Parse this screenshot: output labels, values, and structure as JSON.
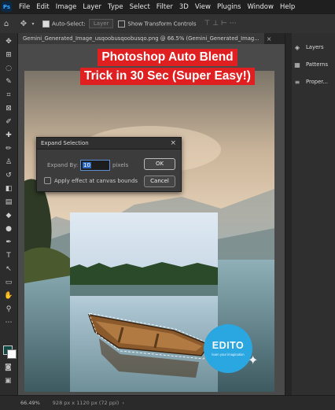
{
  "app": {
    "logo_text": "Ps"
  },
  "menu": [
    "File",
    "Edit",
    "Image",
    "Layer",
    "Type",
    "Select",
    "Filter",
    "3D",
    "View",
    "Plugins",
    "Window",
    "Help"
  ],
  "options_bar": {
    "auto_select_label": "Auto-Select:",
    "layer_value": "Layer",
    "transform_label": "Show Transform Controls"
  },
  "document_tabs": [
    "Gemini_Generated_Image_usqoobusqoobusqo.png @ 66.5% (Gemini_Generated_Imag..."
  ],
  "tools": [
    "move-tool-icon",
    "artboard-icon",
    "lasso-icon",
    "quick-select-icon",
    "crop-icon",
    "frame-icon",
    "eyedropper-icon",
    "healing-brush-icon",
    "brush-icon",
    "clone-stamp-icon",
    "history-brush-icon",
    "eraser-icon",
    "gradient-icon",
    "blur-icon",
    "dodge-icon",
    "pen-icon",
    "type-icon",
    "path-select-icon",
    "rectangle-icon",
    "hand-icon",
    "zoom-icon",
    "more-tools-icon"
  ],
  "tool_glyphs": [
    "✥",
    "⊞",
    "◌",
    "✎",
    "⌗",
    "⊠",
    "✐",
    "✚",
    "✏",
    "♙",
    "↺",
    "◧",
    "▤",
    "◆",
    "●",
    "✒",
    "T",
    "↖",
    "▭",
    "✋",
    "⚲",
    "⋯"
  ],
  "colors": {
    "foreground": "#0f4a45",
    "background": "#ffffff",
    "title_bg": "#e02020",
    "logo_bg": "#2aa6e0"
  },
  "panels": [
    {
      "icon": "layers-icon",
      "glyph": "◈",
      "label": "Layers"
    },
    {
      "icon": "patterns-icon",
      "glyph": "▦",
      "label": "Patterns"
    },
    {
      "icon": "properties-icon",
      "glyph": "≡",
      "label": "Proper..."
    }
  ],
  "video_title": {
    "line1": "Photoshop Auto Blend",
    "line2": "Trick in 30 Sec (Super Easy!)"
  },
  "dialog": {
    "title": "Expand Selection",
    "expand_by_label": "Expand By:",
    "expand_by_value": "10",
    "unit": "pixels",
    "checkbox_label": "Apply effect at canvas bounds",
    "ok_label": "OK",
    "cancel_label": "Cancel"
  },
  "watermark": {
    "text": "EDITO",
    "tagline": "learn your imagination"
  },
  "status": {
    "zoom": "66.49%",
    "doc_info": "928 px x 1120 px (72 ppi)"
  }
}
